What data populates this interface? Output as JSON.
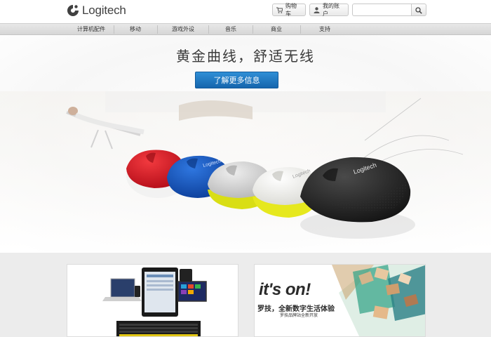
{
  "brand": {
    "name": "Logitech"
  },
  "header": {
    "cart_label": "购物车",
    "account_label": "我的账户",
    "search_placeholder": ""
  },
  "nav": {
    "items": [
      {
        "label": "计算机配件"
      },
      {
        "label": "移动"
      },
      {
        "label": "游戏外设"
      },
      {
        "label": "音乐"
      },
      {
        "label": "商业"
      },
      {
        "label": "支持"
      }
    ]
  },
  "hero": {
    "title": "黄金曲线，舒适无线",
    "cta_label": "了解更多信息",
    "mouse_brand": "Logitech",
    "mouse_colors": [
      "#d8101f",
      "#0e4fb9",
      "#c9c9c9",
      "#f1f1ec",
      "#1c1c1c"
    ],
    "accent_color": "#e1e51a"
  },
  "promo": {
    "right_title": "it's on!",
    "right_subtitle": "罗技，全新数字生活体验",
    "right_caption": "罗技品牌站全新开放"
  },
  "colors": {
    "cta": "#1a72bf",
    "nav_bg": "#dedede",
    "promo_bg": "#ececec"
  }
}
